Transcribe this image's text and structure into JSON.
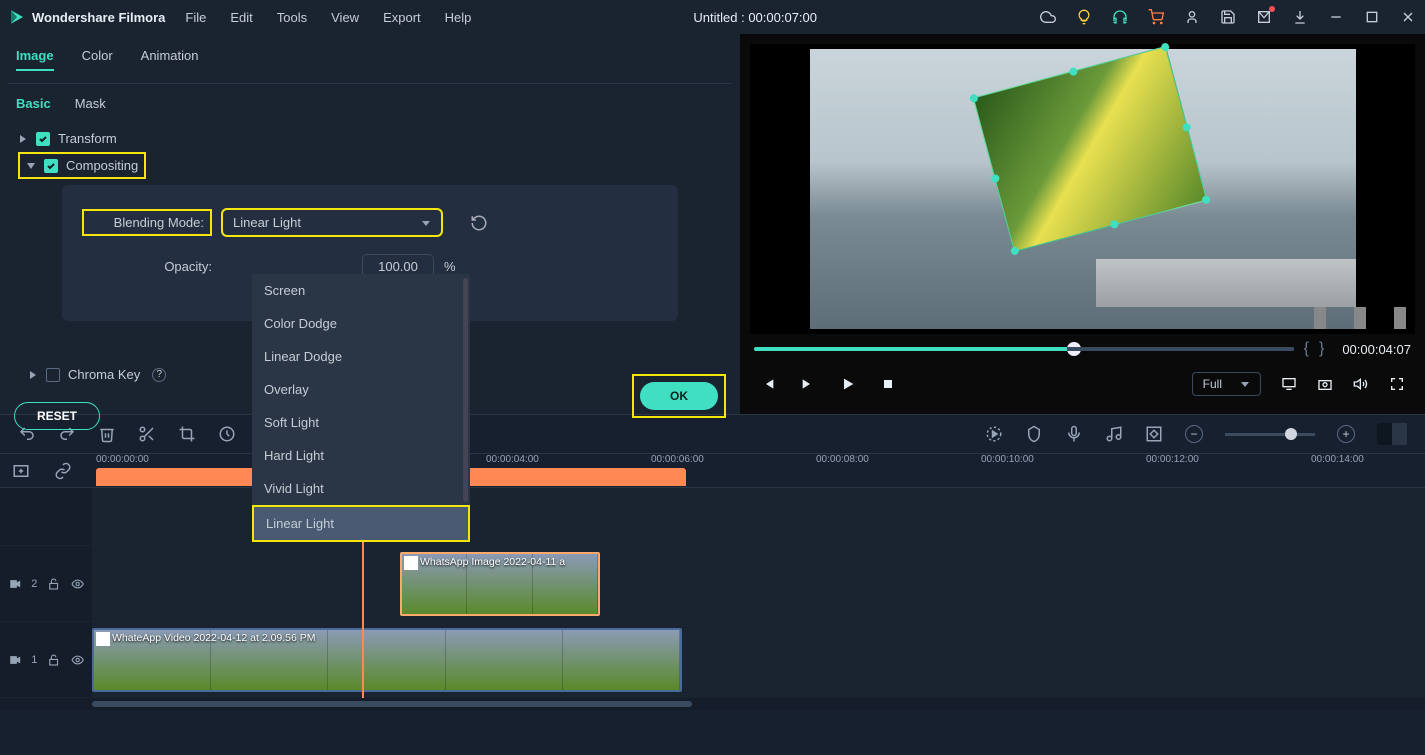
{
  "titlebar": {
    "app_name": "Wondershare Filmora",
    "project_title": "Untitled : 00:00:07:00",
    "menus": [
      "File",
      "Edit",
      "Tools",
      "View",
      "Export",
      "Help"
    ]
  },
  "tabs": {
    "image": "Image",
    "color": "Color",
    "animation": "Animation"
  },
  "subtabs": {
    "basic": "Basic",
    "mask": "Mask"
  },
  "properties": {
    "transform": "Transform",
    "compositing": "Compositing",
    "blending_label": "Blending Mode:",
    "blending_value": "Linear Light",
    "opacity_label": "Opacity:",
    "opacity_value": "100.00",
    "opacity_unit": "%",
    "chroma": "Chroma Key",
    "reset": "RESET",
    "ok": "OK"
  },
  "blend_options": [
    "Screen",
    "Color Dodge",
    "Linear Dodge",
    "Overlay",
    "Soft Light",
    "Hard Light",
    "Vivid Light",
    "Linear Light"
  ],
  "preview": {
    "timecode": "00:00:04:07",
    "quality": "Full"
  },
  "timeline": {
    "start": "00:00:00:00",
    "marks": [
      "00:00:04:00",
      "00:00:06:00",
      "00:00:08:00",
      "00:00:10:00",
      "00:00:12:00",
      "00:00:14:00"
    ],
    "track2_label": "2",
    "track1_label": "1",
    "clip2_name": "WhatsApp Image 2022-04-11 a",
    "clip1_name": "WhateApp Video 2022-04-12 at 2.09.56 PM"
  }
}
